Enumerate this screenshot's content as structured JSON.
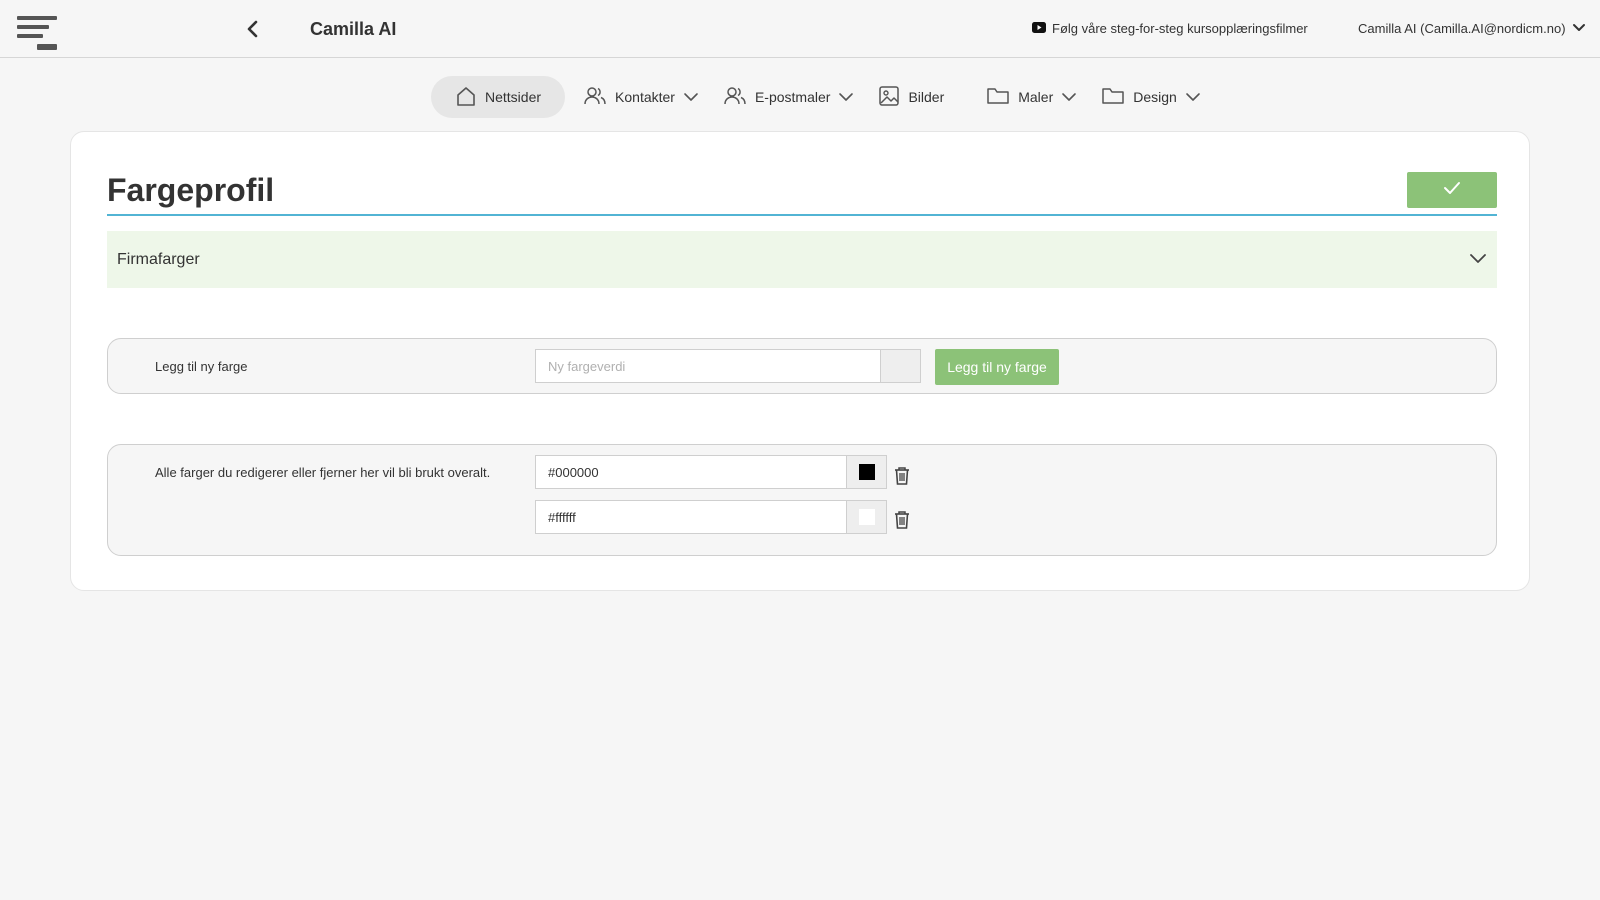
{
  "header": {
    "app_title": "Camilla AI",
    "tutorial_link": "Følg våre steg-for-steg kursopplæringsfilmer",
    "user_label": "Camilla AI (Camilla.AI@nordicm.no)"
  },
  "nav": {
    "items": [
      {
        "label": "Nettsider",
        "icon": "home-icon",
        "active": true,
        "dropdown": false
      },
      {
        "label": "Kontakter",
        "icon": "users-icon",
        "dropdown": true
      },
      {
        "label": "E-postmaler",
        "icon": "users-icon",
        "dropdown": true
      },
      {
        "label": "Bilder",
        "icon": "image-icon",
        "dropdown": false
      },
      {
        "label": "Maler",
        "icon": "folder-icon",
        "dropdown": true
      },
      {
        "label": "Design",
        "icon": "folder-icon",
        "dropdown": true
      }
    ]
  },
  "page": {
    "title": "Fargeprofil",
    "section_title": "Firmafarger"
  },
  "add_color": {
    "label": "Legg til ny farge",
    "input_value": "",
    "input_placeholder": "Ny fargeverdi",
    "button_label": "Legg til ny farge"
  },
  "color_list": {
    "description": "Alle farger du redigerer eller fjerner her vil bli brukt overalt.",
    "colors": [
      {
        "value": "#000000",
        "swatch": "#000000"
      },
      {
        "value": "#ffffff",
        "swatch": "#ffffff"
      }
    ]
  },
  "colors": {
    "accent_green": "#8cc278",
    "section_bg": "#eef7e9",
    "title_rule": "#52b4d4"
  }
}
